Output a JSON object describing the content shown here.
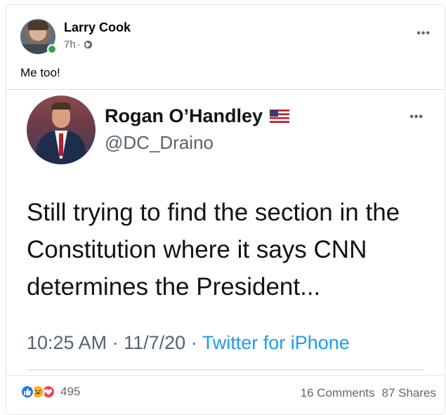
{
  "post": {
    "author_name": "Larry Cook",
    "time": "7h",
    "separator": "·",
    "text": "Me too!",
    "more_label": "•••"
  },
  "tweet": {
    "name": "Rogan O’Handley",
    "handle": "@DC_Draino",
    "more_label": "•••",
    "text": "Still trying to find the section in the Constitution where it says CNN determines the President...",
    "time": "10:25 AM",
    "date": "11/7/20",
    "dot": "·",
    "source": "Twitter for iPhone"
  },
  "stats": {
    "reaction_count": "495",
    "comments": "16 Comments",
    "shares": "87 Shares"
  },
  "icons": {
    "globe": "globe-icon",
    "online": "online-dot",
    "flag": "us-flag-icon",
    "like": "like-icon",
    "haha": "haha-icon",
    "love": "love-icon"
  },
  "colors": {
    "link": "#1d9bf0",
    "online": "#31a24c",
    "like": "#1877f2",
    "love": "#f33e58"
  }
}
